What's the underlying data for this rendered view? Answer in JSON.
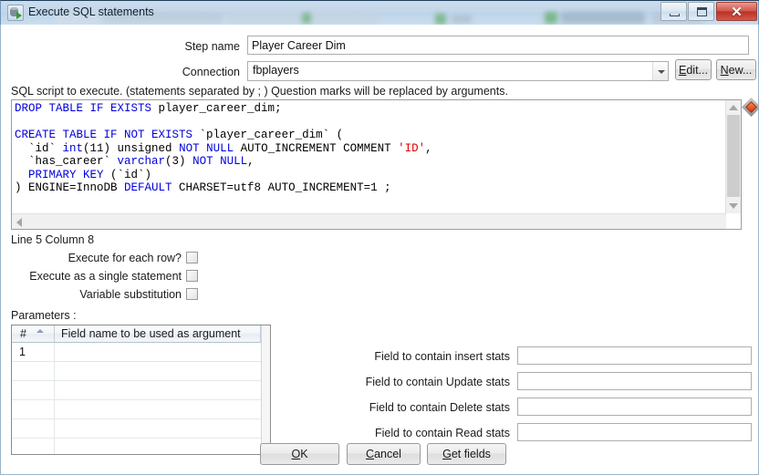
{
  "window": {
    "title": "Execute SQL statements",
    "icon": "sql-execute-icon",
    "controls": {
      "minimize": "minimize-icon",
      "maximize": "maximize-icon",
      "close": "✕"
    }
  },
  "form": {
    "step_name_label": "Step name",
    "step_name_value": "Player Career Dim",
    "connection_label": "Connection",
    "connection_value": "fbplayers",
    "edit_button": "Edit...",
    "edit_button_mnemonic": "E",
    "new_button": "New...",
    "new_button_mnemonic": "N"
  },
  "sql": {
    "hint": "SQL script to execute. (statements separated by ; ) Question marks will be replaced by arguments.",
    "lines": [
      {
        "text": "DROP TABLE IF EXISTS player_career_dim;"
      },
      {
        "text": ""
      },
      {
        "text": "CREATE TABLE IF NOT EXISTS `player_career_dim` ("
      },
      {
        "text": "  `id` int(11) unsigned NOT NULL AUTO_INCREMENT COMMENT 'ID',"
      },
      {
        "text": "  `has_career` varchar(3) NOT NULL,"
      },
      {
        "text": "  PRIMARY KEY (`id`)"
      },
      {
        "text": ") ENGINE=InnoDB DEFAULT CHARSET=utf8 AUTO_INCREMENT=1 ;"
      }
    ],
    "caret_status": "Line 5 Column 8",
    "marker_icon": "error-marker-diamond-icon"
  },
  "options": [
    {
      "label": "Execute for each row?",
      "checked": false,
      "name": "execute-for-each-row"
    },
    {
      "label": "Execute as a single statement",
      "checked": false,
      "name": "execute-as-single-statement"
    },
    {
      "label": "Variable substitution",
      "checked": false,
      "name": "variable-substitution"
    }
  ],
  "parameters": {
    "label": "Parameters :",
    "columns": [
      "#",
      "Field name to be used as argument"
    ],
    "sort_column": 0,
    "sort_direction": "asc",
    "rows": [
      {
        "num": "1",
        "field": ""
      },
      {
        "num": "",
        "field": ""
      },
      {
        "num": "",
        "field": ""
      },
      {
        "num": "",
        "field": ""
      },
      {
        "num": "",
        "field": ""
      }
    ]
  },
  "stats_fields": [
    {
      "label": "Field to contain insert stats",
      "value": "",
      "name": "insert-stats-field"
    },
    {
      "label": "Field to contain Update stats",
      "value": "",
      "name": "update-stats-field"
    },
    {
      "label": "Field to contain Delete stats",
      "value": "",
      "name": "delete-stats-field"
    },
    {
      "label": "Field to contain Read stats",
      "value": "",
      "name": "read-stats-field"
    }
  ],
  "footer": {
    "ok": "OK",
    "ok_mnemonic": "O",
    "cancel": "Cancel",
    "cancel_mnemonic": "C",
    "get_fields": "Get fields",
    "get_fields_mnemonic": "G"
  },
  "colors": {
    "titlebar": "#c3d7ea",
    "close_button": "#b93126",
    "sql_keyword": "#0000dd",
    "sql_string": "#dd0000",
    "marker": "#e03010"
  }
}
